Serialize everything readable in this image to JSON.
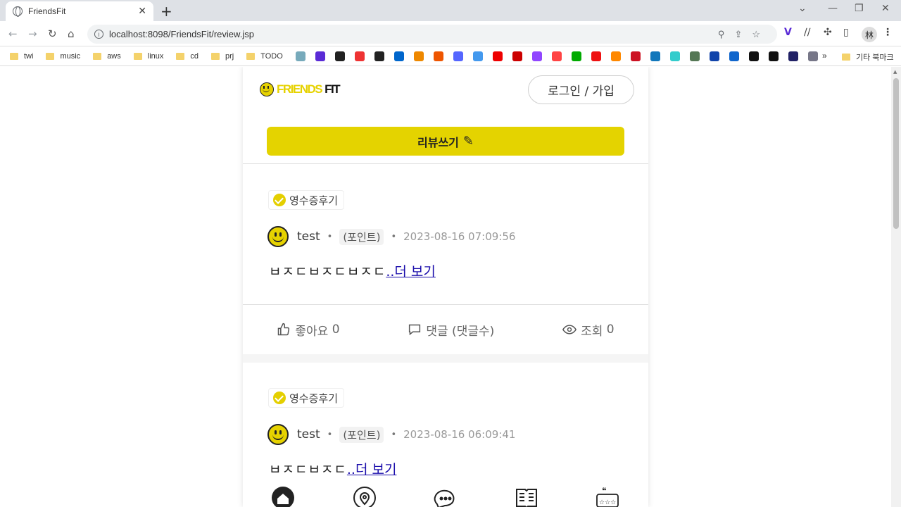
{
  "browser": {
    "tab_title": "FriendsFit",
    "url": "localhost:8098/FriendsFit/review.jsp",
    "profile_label": "林",
    "bookmarks": [
      "twi",
      "music",
      "aws",
      "linux",
      "cd",
      "prj",
      "TODO"
    ],
    "bookmark_icon_colors": [
      "#7ab",
      "#5a2bd6",
      "#222",
      "#e33",
      "#222",
      "#06c",
      "#e80",
      "#e50",
      "#56f",
      "#49e",
      "#e00",
      "#c00",
      "#9146ff",
      "#f44",
      "#0a0",
      "#e11",
      "#f80",
      "#c12",
      "#17b",
      "#3cc",
      "#575",
      "#14a",
      "#16c",
      "#111",
      "#111",
      "#226",
      "#778"
    ],
    "bookmarks_more": "»",
    "other_bookmarks": "기타 북마크"
  },
  "header": {
    "logo_friends": "FRIENDS",
    "logo_fit": "FIT",
    "login_label": "로그인 / 가입"
  },
  "write_button": {
    "label": "리뷰쓰기"
  },
  "reviews": [
    {
      "badge": "영수증후기",
      "author": "test",
      "point": "(포인트)",
      "date": "2023-08-16 07:09:56",
      "content": "ㅂㅈㄷㅂㅈㄷㅂㅈㄷ",
      "more": "..더 보기",
      "likes_label": "좋아요",
      "likes": "0",
      "comments_label": "댓글 (댓글수)",
      "views_label": "조회",
      "views": "0"
    },
    {
      "badge": "영수증후기",
      "author": "test",
      "point": "(포인트)",
      "date": "2023-08-16 06:09:41",
      "content": "ㅂㅈㄷㅂㅈㄷ",
      "more": "..더 보기"
    }
  ],
  "colors": {
    "accent": "#e4d300"
  }
}
